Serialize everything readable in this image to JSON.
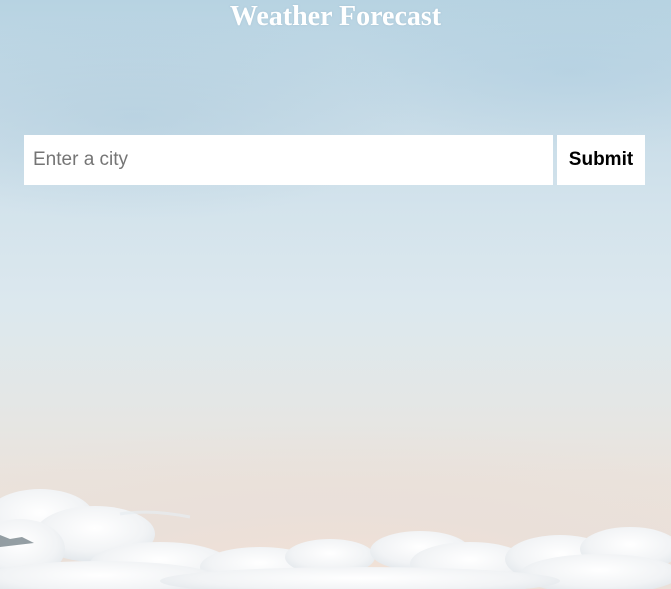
{
  "header": {
    "title": "Weather Forecast"
  },
  "search": {
    "placeholder": "Enter a city",
    "value": "",
    "submit_label": "Submit"
  },
  "background": {
    "image": "sky-with-clouds",
    "sky_color_top": "#b7d3e2",
    "sky_color_bottom": "#eee2da"
  }
}
